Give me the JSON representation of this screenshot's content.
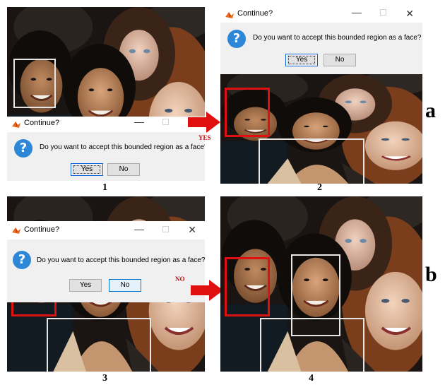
{
  "panels": [
    {
      "id": "1",
      "label": "1"
    },
    {
      "id": "2",
      "label": "2"
    },
    {
      "id": "3",
      "label": "3"
    },
    {
      "id": "4",
      "label": "4"
    }
  ],
  "dialog": {
    "title": "Continue?",
    "message": "Do you want to accept this bounded region as a face?",
    "yes_label": "Yes",
    "no_label": "No",
    "minimize_glyph": "—",
    "maximize_glyph": "☐",
    "close_glyph": "✕",
    "question_glyph": "?"
  },
  "arrows": {
    "top_label": "YES",
    "bottom_label": "NO"
  },
  "row_labels": {
    "top": "a",
    "bottom": "b"
  },
  "colors": {
    "accent_red": "#e01010",
    "box_white": "#e6e6e6",
    "question_blue": "#2d86d6"
  }
}
